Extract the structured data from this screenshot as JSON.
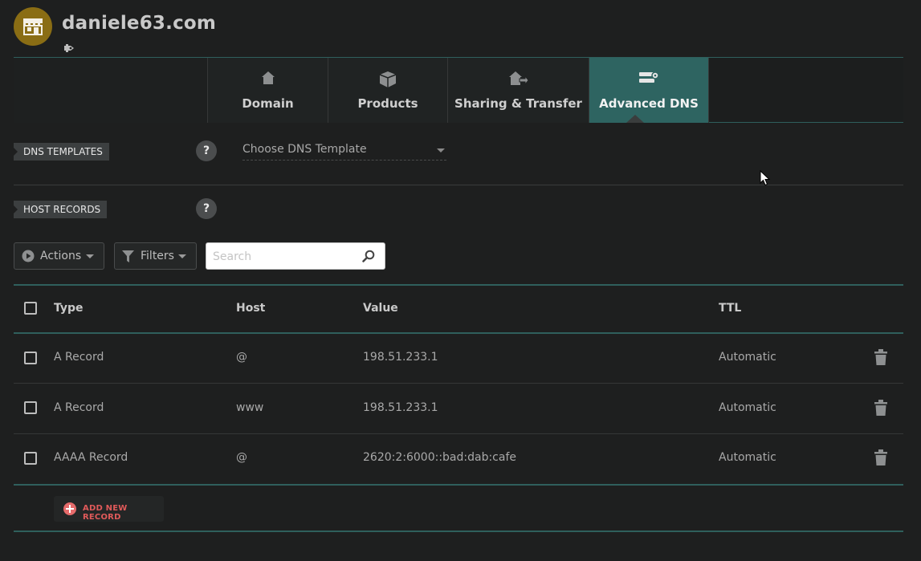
{
  "header": {
    "domain": "daniele63.com",
    "logo_icon": "store-icon",
    "sub_icon": "tag-icon"
  },
  "tabs": [
    {
      "label": "Domain",
      "icon": "home-icon"
    },
    {
      "label": "Products",
      "icon": "box-icon"
    },
    {
      "label": "Sharing & Transfer",
      "icon": "share-home-icon"
    },
    {
      "label": "Advanced DNS",
      "icon": "server-gear-icon",
      "active": true
    }
  ],
  "dns_templates": {
    "label": "DNS TEMPLATES",
    "help": "?",
    "select_value": "Choose DNS Template"
  },
  "host_records": {
    "label": "HOST RECORDS",
    "help": "?"
  },
  "toolbar": {
    "actions_label": "Actions",
    "filters_label": "Filters",
    "search_placeholder": "Search"
  },
  "table": {
    "columns": [
      "Type",
      "Host",
      "Value",
      "TTL"
    ],
    "rows": [
      {
        "type": "A Record",
        "host": "@",
        "value": "198.51.233.1",
        "ttl": "Automatic"
      },
      {
        "type": "A Record",
        "host": "www",
        "value": "198.51.233.1",
        "ttl": "Automatic"
      },
      {
        "type": "AAAA Record",
        "host": "@",
        "value": "2620:2:6000::bad:dab:cafe",
        "ttl": "Automatic"
      }
    ]
  },
  "add_record_label": "ADD NEW RECORD",
  "colors": {
    "accent": "#2e6461",
    "logo_bg": "#8a6d14",
    "add_red": "#e05a5a"
  }
}
